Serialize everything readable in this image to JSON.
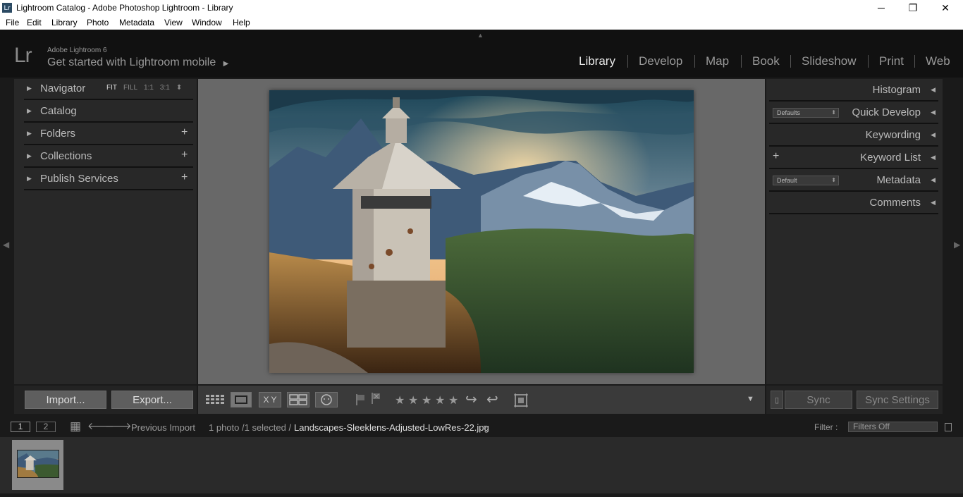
{
  "window": {
    "title": "Lightroom Catalog - Adobe Photoshop Lightroom - Library",
    "app_icon": "Lr",
    "controls": {
      "minimize": "─",
      "maximize": "❐",
      "close": "✕"
    }
  },
  "menu": [
    "File",
    "Edit",
    "Library",
    "Photo",
    "Metadata",
    "View",
    "Window",
    "Help"
  ],
  "identity": {
    "logo": "Lr",
    "brand": "Adobe Lightroom 6",
    "mobile_prompt": "Get started with Lightroom mobile",
    "mobile_arrow": "▶",
    "top_toggle": "▲"
  },
  "modules": {
    "items": [
      "Library",
      "Develop",
      "Map",
      "Book",
      "Slideshow",
      "Print",
      "Web"
    ],
    "active": "Library"
  },
  "left_panel": {
    "navigator": {
      "label": "Navigator",
      "opts": [
        "FIT",
        "FILL",
        "1:1",
        "3:1"
      ],
      "stepper": "⬍"
    },
    "catalog": "Catalog",
    "folders": "Folders",
    "collections": "Collections",
    "publish": "Publish Services",
    "plus": "+",
    "expand": "▶",
    "import_label": "Import...",
    "export_label": "Export..."
  },
  "right_panel": {
    "histogram": "Histogram",
    "quick_develop": "Quick Develop",
    "quick_preset": "Defaults",
    "keywording": "Keywording",
    "keyword_list": "Keyword List",
    "metadata": "Metadata",
    "metadata_preset": "Default",
    "comments": "Comments",
    "collapse": "◀",
    "plus": "+",
    "stepper": "⬍",
    "sync_label": "Sync",
    "sync_settings_label": "Sync Settings",
    "sync_switch": "▯"
  },
  "toolbar": {
    "compare_label": "X Y",
    "stars": [
      "★",
      "★",
      "★",
      "★",
      "★"
    ],
    "rotate_left": "↪",
    "rotate_right": "↩",
    "menu_arrow": "▼"
  },
  "filmstrip_bar": {
    "pages": [
      "1",
      "2"
    ],
    "source": "Previous Import",
    "count": "1 photo /1 selected /",
    "filename": "Landscapes-Sleeklens-Adjusted-LowRes-22.jpg",
    "dropdown": "▼",
    "filter_label": "Filter :",
    "filter_value": "Filters Off",
    "grid_icon": "▦",
    "back": "🡐",
    "forward": "🡒"
  },
  "edges": {
    "left": "◀",
    "right": "▶"
  },
  "colors": {
    "accent": "#e8e8e8",
    "panel": "#282828",
    "canvas": "#686868"
  }
}
